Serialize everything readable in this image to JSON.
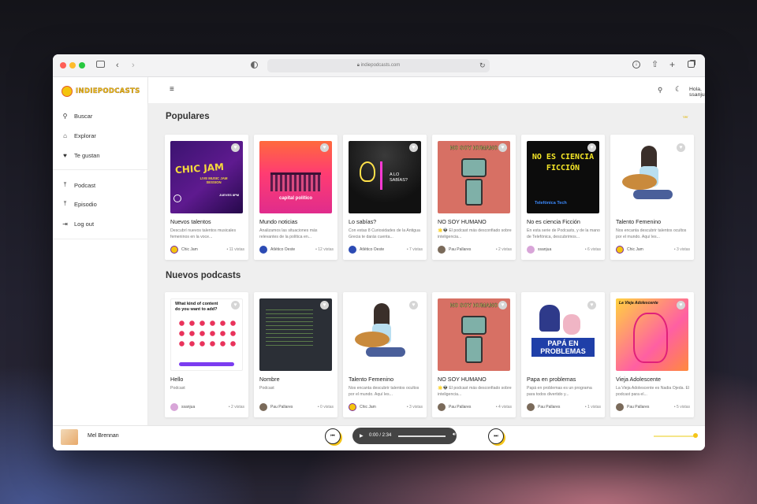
{
  "browser": {
    "url": "indiepodcasts.com"
  },
  "app": {
    "logo_text": "INDIEPODCASTS"
  },
  "sidebar": {
    "main": [
      {
        "label": "Buscar",
        "icon": "search-icon"
      },
      {
        "label": "Explorar",
        "icon": "home-icon"
      },
      {
        "label": "Te gustan",
        "icon": "heart-icon"
      }
    ],
    "secondary": [
      {
        "label": "Podcast",
        "icon": "upload-icon"
      },
      {
        "label": "Episodio",
        "icon": "upload-icon"
      },
      {
        "label": "Log out",
        "icon": "logout-icon"
      }
    ]
  },
  "header": {
    "greeting": "Hola, ssanjua!"
  },
  "sections": {
    "popular_title": "Populares",
    "new_title": "Nuevos podcasts",
    "popular_more": "Ver"
  },
  "popular": [
    {
      "title": "Nuevos talentos",
      "desc": "Descubrí nuevos talentos musicales femeninos en la voce...",
      "author": "Chic Jam",
      "views": "• 11 vistas",
      "cover_text": "CHIC JAM",
      "cover_sub": "LIVE MUSIC JAM SESSION",
      "cover_date": "JUEVES 8PM"
    },
    {
      "title": "Mundo noticias",
      "desc": "Analizamos las situaciones más relevantes de la política en...",
      "author": "Atlético Oeste",
      "views": "• 12 vistas",
      "cover_text": "capital político"
    },
    {
      "title": "Lo sabías?",
      "desc": "Con estas 8 Curiosidades de la Antigua Grecia te darás cuenta...",
      "author": "Atlético Oeste",
      "views": "• 7 vistas",
      "cover_text": "A LO SABÍAS?"
    },
    {
      "title": "NO SOY HUMANO",
      "desc": "🌟👽 El podcast más desconfiado sobre inteligencia...",
      "author": "Pau Pallares",
      "views": "• 2 vistas",
      "cover_text": "NO SOY HUMANO"
    },
    {
      "title": "No es ciencia Ficción",
      "desc": "En esta serie de Podcasts, y de la mano de Telefónica, descubrimos...",
      "author": "ssanjua",
      "views": "• 6 vistas",
      "cover_text": "NO ES CIENCIA FICCIÓN",
      "cover_sub": "Telefónica Tech"
    },
    {
      "title": "Talento Femenino",
      "desc": "Nos encanta descubrir talentos ocultos por el mundo. Aquí les...",
      "author": "Chic Jam",
      "views": "• 3 vistas"
    }
  ],
  "new_podcasts": [
    {
      "title": "Hello",
      "desc": "Podcast",
      "author": "ssanjua",
      "views": "• 2 vistas",
      "cover_text": "What kind of content do you want to add?"
    },
    {
      "title": "Nombre",
      "desc": "Podcast",
      "author": "Pau Pallares",
      "views": "• 0 vistas"
    },
    {
      "title": "Talento Femenino",
      "desc": "Nos encanta descubrir talentos ocultos por el mundo. Aquí les...",
      "author": "Chic Jam",
      "views": "• 3 vistas"
    },
    {
      "title": "NO SOY HUMANO",
      "desc": "🌟👽 El podcast más desconfiado sobre inteligencia...",
      "author": "Pau Pallares",
      "views": "• 4 vistas",
      "cover_text": "NO SOY HUMANO"
    },
    {
      "title": "Papa en problemas",
      "desc": "Papá en problemas es un programa para todos divertido y...",
      "author": "Pau Pallares",
      "views": "• 1 vistas",
      "cover_text": "PAPÁ EN PROBLEMAS"
    },
    {
      "title": "Vieja Adolescente",
      "desc": "La Vieja Adolescente es Nadia Ojeda. El podcast para el...",
      "author": "Pau Pallares",
      "views": "• 5 vistas",
      "cover_text": "La Vieja Adolescente"
    }
  ],
  "player": {
    "track": "Mel Brennan",
    "time": "0:00 / 2:34",
    "progress": 0.0,
    "volume": 1.0
  },
  "colors": {
    "accent": "#f5c518",
    "logo": "#f0be12",
    "content_bg": "#efefef"
  }
}
